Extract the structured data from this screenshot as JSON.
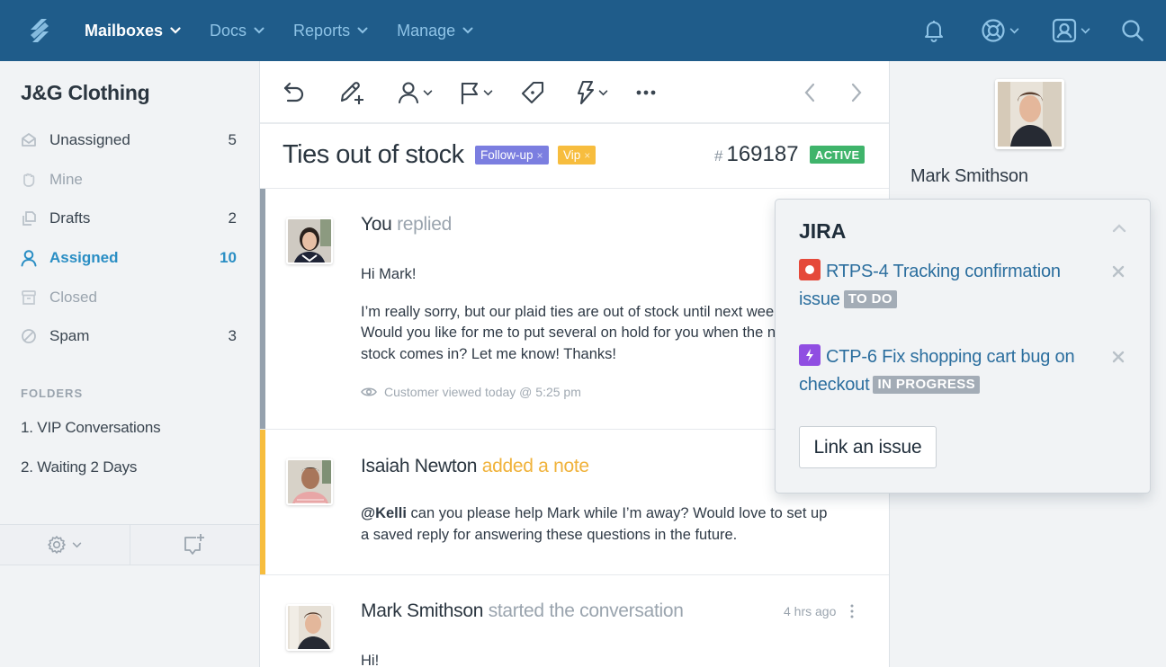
{
  "topnav": {
    "logo": "helpscout-logo-icon",
    "items": [
      {
        "label": "Mailboxes",
        "active": true
      },
      {
        "label": "Docs",
        "active": false
      },
      {
        "label": "Reports",
        "active": false
      },
      {
        "label": "Manage",
        "active": false
      }
    ],
    "right_icons": [
      "bell-icon",
      "lifebuoy-icon",
      "user-profile-icon",
      "search-icon"
    ]
  },
  "sidebar": {
    "mailbox_name": "J&G Clothing",
    "folders": [
      {
        "label": "Unassigned",
        "count": "5",
        "icon": "envelope-open-icon",
        "state": "normal"
      },
      {
        "label": "Mine",
        "count": "",
        "icon": "hand-icon",
        "state": "muted"
      },
      {
        "label": "Drafts",
        "count": "2",
        "icon": "drafts-icon",
        "state": "normal"
      },
      {
        "label": "Assigned",
        "count": "10",
        "icon": "person-icon",
        "state": "active"
      },
      {
        "label": "Closed",
        "count": "",
        "icon": "archive-icon",
        "state": "muted"
      },
      {
        "label": "Spam",
        "count": "3",
        "icon": "block-icon",
        "state": "normal"
      }
    ],
    "folders_heading": "FOLDERS",
    "custom_folders": [
      "1. VIP Conversations",
      "2. Waiting 2 Days"
    ],
    "footer": {
      "settings_icon": "gear-icon",
      "new_conversation_icon": "new-conversation-icon"
    }
  },
  "toolbar": {
    "buttons": [
      "reply-icon",
      "add-note-icon",
      "assign-icon",
      "status-flag-icon",
      "tag-icon",
      "workflow-icon",
      "more-icon"
    ],
    "nav": [
      "previous-icon",
      "next-icon"
    ]
  },
  "conversation": {
    "subject": "Ties out of stock",
    "tags": [
      {
        "label": "Follow-up",
        "color": "#7b7ee0"
      },
      {
        "label": "Vip",
        "color": "#f7bd3e"
      }
    ],
    "number_prefix": "#",
    "number": "169187",
    "status": "ACTIVE",
    "status_color": "#3fb46b"
  },
  "threads": [
    {
      "author": "You",
      "action": "replied",
      "type": "reply",
      "bar_color": "#95a1ad",
      "body": [
        "Hi Mark!",
        "I’m really sorry, but our plaid ties are out of stock until next wee",
        "Would you like for me to put several on hold for you when the n",
        "stock comes in? Let me know! Thanks!"
      ],
      "meta": "Customer viewed today @ 5:25 pm"
    },
    {
      "author": "Isaiah Newton",
      "action": "added a note",
      "type": "note",
      "bar_color": "#f7bd3e",
      "mention": "@Kelli",
      "body": [
        " can you please help Mark while I’m away? Would love to set up",
        "a saved reply for answering these questions in the future."
      ]
    },
    {
      "author": "Mark Smithson",
      "action": "started the conversation",
      "type": "customer",
      "time": "4 hrs ago",
      "body": [
        "Hi!"
      ]
    }
  ],
  "customer": {
    "name": "Mark Smithson"
  },
  "jira": {
    "title": "JIRA",
    "issues": [
      {
        "key_title_line1": "RTPS-4 Tracking confirmation",
        "line2": "issue",
        "status": "TO DO",
        "type": "bug"
      },
      {
        "key_title_line1": "CTP-6 Fix shopping cart bug on",
        "line2": "checkout",
        "status": "IN PROGRESS",
        "type": "task"
      }
    ],
    "link_button": "Link an issue"
  }
}
